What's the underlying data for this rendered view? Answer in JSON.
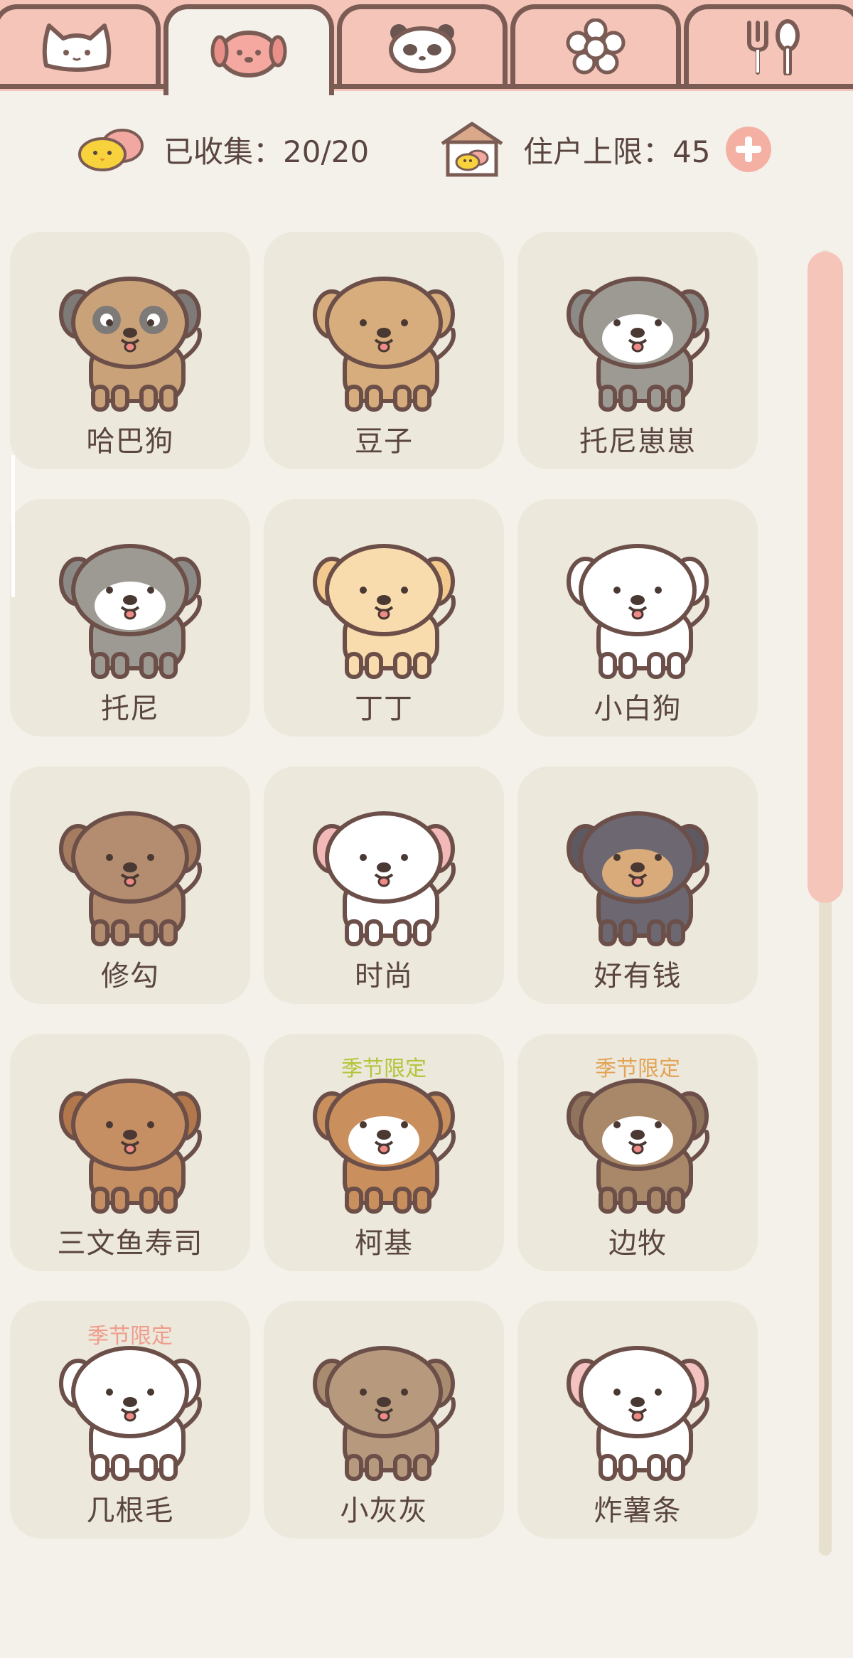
{
  "tabs": [
    {
      "icon": "cat-face-icon",
      "active": false
    },
    {
      "icon": "dog-face-icon",
      "active": true
    },
    {
      "icon": "panda-face-icon",
      "active": false
    },
    {
      "icon": "flower-icon",
      "active": false
    },
    {
      "icon": "fork-spoon-icon",
      "active": false
    }
  ],
  "stats": {
    "collected_label": "已收集：20/20",
    "residents_label": "住户上限：45"
  },
  "dogs": [
    {
      "name": "哈巴狗",
      "badge": "",
      "body": "#c9a27a",
      "ear": "#7e7a78",
      "face": "#c9a27a",
      "mask": "#7e7a78"
    },
    {
      "name": "豆子",
      "badge": "",
      "body": "#d7ad7e",
      "ear": "#d7ad7e",
      "face": "#d7ad7e",
      "mask": ""
    },
    {
      "name": "托尼崽崽",
      "badge": "",
      "body": "#9d9a93",
      "ear": "#8c8a86",
      "face": "#ffffff",
      "mask": ""
    },
    {
      "name": "托尼",
      "badge": "",
      "body": "#9d9a93",
      "ear": "#8c8a86",
      "face": "#ffffff",
      "mask": ""
    },
    {
      "name": "丁丁",
      "badge": "",
      "body": "#f9dcae",
      "ear": "#f3c98e",
      "face": "#f9dcae",
      "mask": ""
    },
    {
      "name": "小白狗",
      "badge": "",
      "body": "#ffffff",
      "ear": "#ffffff",
      "face": "#ffffff",
      "mask": ""
    },
    {
      "name": "修勾",
      "badge": "",
      "body": "#b48c6f",
      "ear": "#a57c5f",
      "face": "#b48c6f",
      "mask": ""
    },
    {
      "name": "时尚",
      "badge": "",
      "body": "#ffffff",
      "ear": "#f3b8b8",
      "face": "#ffffff",
      "mask": ""
    },
    {
      "name": "好有钱",
      "badge": "",
      "body": "#6c6770",
      "ear": "#5e5860",
      "face": "#d9aa7a",
      "mask": ""
    },
    {
      "name": "三文鱼寿司",
      "badge": "",
      "body": "#c58f63",
      "ear": "#b3774c",
      "face": "#c58f63",
      "mask": ""
    },
    {
      "name": "柯基",
      "badge": "季节限定",
      "badge_color": "#b5c43a",
      "body": "#c98f5d",
      "ear": "#c98f5d",
      "face": "#ffffff",
      "mask": ""
    },
    {
      "name": "边牧",
      "badge": "季节限定",
      "badge_color": "#e2a355",
      "body": "#a88868",
      "ear": "#8f735a",
      "face": "#ffffff",
      "mask": ""
    },
    {
      "name": "几根毛",
      "badge": "季节限定",
      "badge_color": "#ef9d8c",
      "body": "#ffffff",
      "ear": "#ffffff",
      "face": "#ffffff",
      "mask": ""
    },
    {
      "name": "小灰灰",
      "badge": "",
      "body": "#b79a7e",
      "ear": "#a98b6f",
      "face": "#b79a7e",
      "mask": ""
    },
    {
      "name": "炸薯条",
      "badge": "",
      "body": "#ffffff",
      "ear": "#f5c2c2",
      "face": "#ffffff",
      "mask": ""
    }
  ],
  "colors": {
    "tab_bg": "#f6c5b9",
    "outline": "#7a5c55",
    "page_bg": "#f4f1ea",
    "card_bg": "#ece8dc",
    "scroll_thumb": "#f6c5b9"
  }
}
